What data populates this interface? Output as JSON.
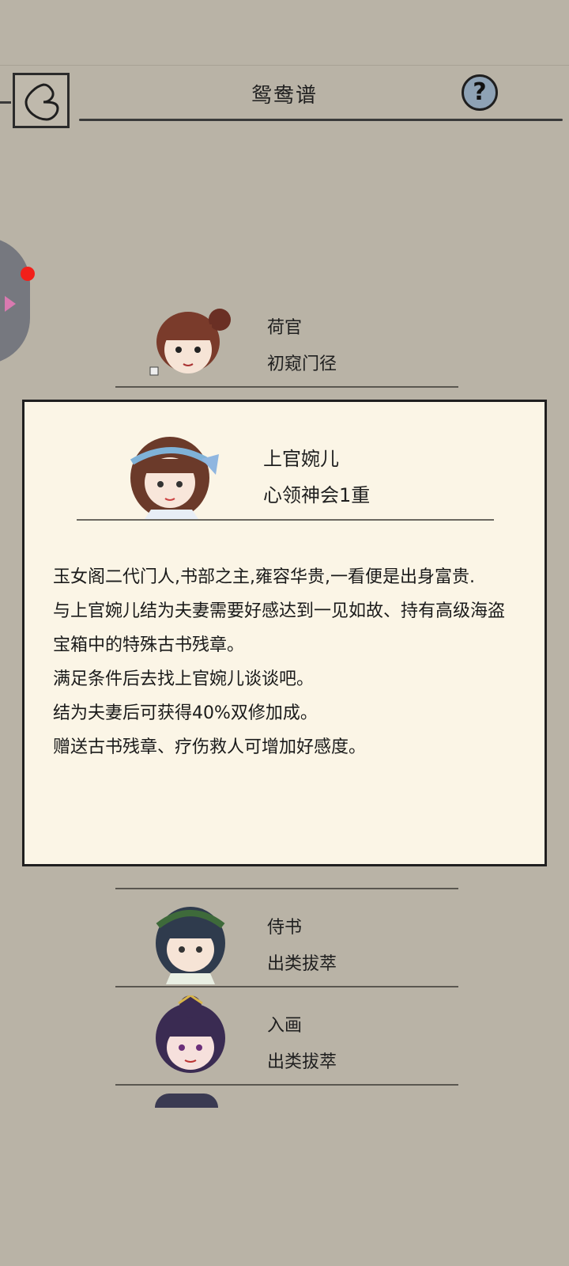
{
  "header": {
    "title": "鸳鸯谱"
  },
  "list": [
    {
      "name": "荷官",
      "rank": "初窥门径"
    },
    {
      "name": "侍书",
      "rank": "出类拔萃"
    },
    {
      "name": "入画",
      "rank": "出类拔萃"
    }
  ],
  "popup": {
    "name": "上官婉儿",
    "rank": "心领神会1重",
    "description": [
      "玉女阁二代门人,书部之主,雍容华贵,一看便是出身富贵.",
      "与上官婉儿结为夫妻需要好感达到一见如故、持有高级海盗宝箱中的特殊古书残章。",
      "满足条件后去找上官婉儿谈谈吧。",
      "结为夫妻后可获得40%双修加成。",
      "赠送古书残章、疗伤救人可增加好感度。"
    ]
  },
  "icons": {
    "back": "back-icon",
    "help": "help-icon"
  }
}
